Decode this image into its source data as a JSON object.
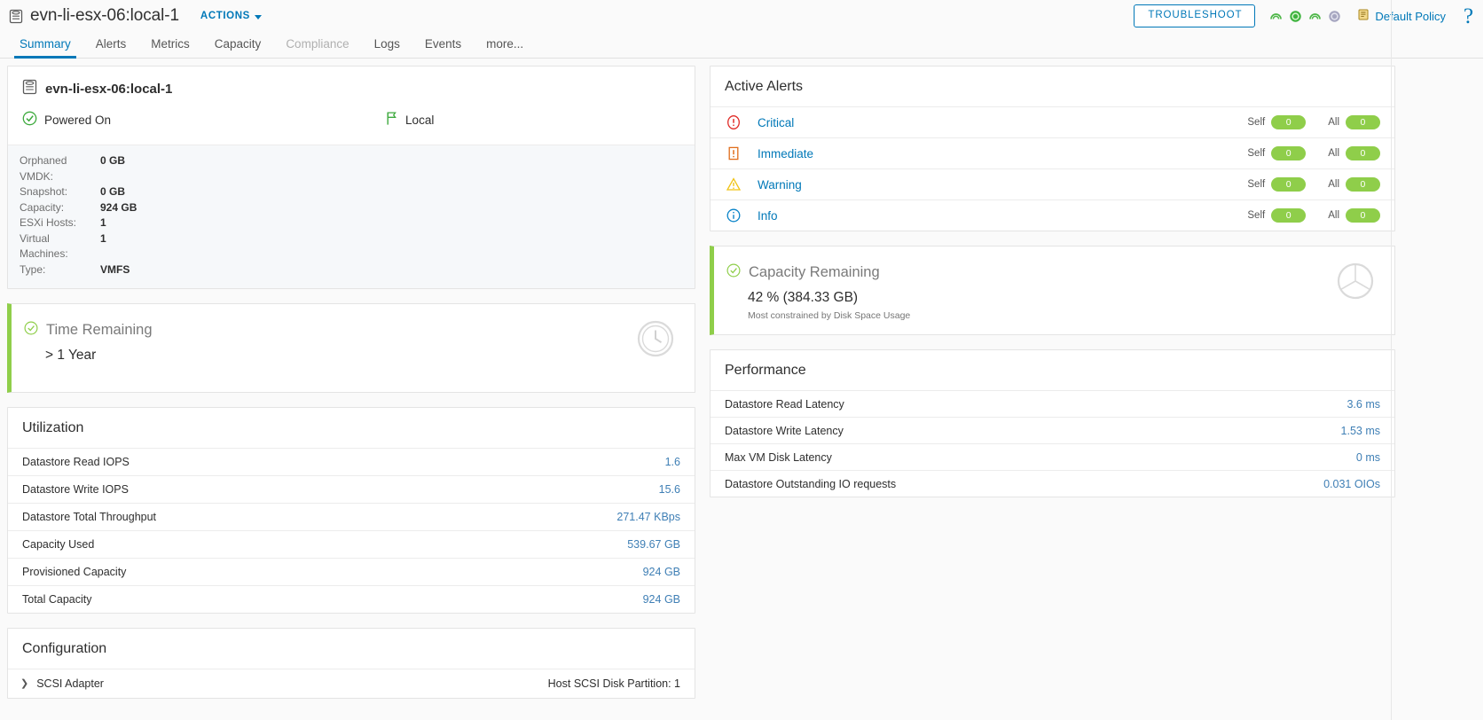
{
  "header": {
    "object_icon": "datastore-icon",
    "title": "evn-li-esx-06:local-1",
    "actions_label": "ACTIONS",
    "troubleshoot_label": "TROUBLESHOOT",
    "policy_label": "Default Policy",
    "help_label": "?",
    "badges": [
      {
        "name": "health-badge",
        "style": "arc-green",
        "color": "#4eb748"
      },
      {
        "name": "risk-badge",
        "style": "circle-green",
        "color": "#3eb33e"
      },
      {
        "name": "efficiency-badge",
        "style": "arc-green",
        "color": "#4eb748"
      },
      {
        "name": "compliance-badge",
        "style": "circle-gray",
        "color": "#a6a6c0"
      }
    ]
  },
  "tabs": [
    {
      "label": "Summary",
      "state": "active"
    },
    {
      "label": "Alerts",
      "state": "normal"
    },
    {
      "label": "Metrics",
      "state": "normal"
    },
    {
      "label": "Capacity",
      "state": "normal"
    },
    {
      "label": "Compliance",
      "state": "disabled"
    },
    {
      "label": "Logs",
      "state": "normal"
    },
    {
      "label": "Events",
      "state": "normal"
    },
    {
      "label": "more...",
      "state": "normal"
    }
  ],
  "object_card": {
    "name": "evn-li-esx-06:local-1",
    "power_state": "Powered On",
    "location": "Local",
    "properties": [
      {
        "key": "Orphaned VMDK:",
        "value": "0 GB"
      },
      {
        "key": "Snapshot:",
        "value": "0 GB"
      },
      {
        "key": "Capacity:",
        "value": "924 GB"
      },
      {
        "key": "ESXi Hosts:",
        "value": "1"
      },
      {
        "key": "Virtual Machines:",
        "value": "1"
      },
      {
        "key": "Type:",
        "value": "VMFS"
      }
    ]
  },
  "active_alerts": {
    "title": "Active Alerts",
    "self_label": "Self",
    "all_label": "All",
    "rows": [
      {
        "icon": "critical-icon",
        "label": "Critical",
        "self": "0",
        "all": "0"
      },
      {
        "icon": "immediate-icon",
        "label": "Immediate",
        "self": "0",
        "all": "0"
      },
      {
        "icon": "warning-icon",
        "label": "Warning",
        "self": "0",
        "all": "0"
      },
      {
        "icon": "info-icon",
        "label": "Info",
        "self": "0",
        "all": "0"
      }
    ]
  },
  "time_remaining": {
    "title": "Time Remaining",
    "value": "> 1 Year",
    "status_color": "#8fce4a",
    "glyph": "clock-icon"
  },
  "capacity_remaining": {
    "title": "Capacity Remaining",
    "value": "42 % (384.33 GB)",
    "subtext": "Most constrained by Disk Space Usage",
    "status_color": "#8fce4a",
    "glyph": "pie-chart-icon"
  },
  "utilization": {
    "title": "Utilization",
    "rows": [
      {
        "name": "Datastore Read IOPS",
        "value": "1.6"
      },
      {
        "name": "Datastore Write IOPS",
        "value": "15.6"
      },
      {
        "name": "Datastore Total Throughput",
        "value": "271.47 KBps"
      },
      {
        "name": "Capacity Used",
        "value": "539.67 GB"
      },
      {
        "name": "Provisioned Capacity",
        "value": "924 GB"
      },
      {
        "name": "Total Capacity",
        "value": "924 GB"
      }
    ]
  },
  "performance": {
    "title": "Performance",
    "rows": [
      {
        "name": "Datastore Read Latency",
        "value": "3.6 ms"
      },
      {
        "name": "Datastore Write Latency",
        "value": "1.53 ms"
      },
      {
        "name": "Max VM Disk Latency",
        "value": "0 ms"
      },
      {
        "name": "Datastore Outstanding IO requests",
        "value": "0.031 OIOs"
      }
    ]
  },
  "configuration": {
    "title": "Configuration",
    "rows": [
      {
        "name": "SCSI Adapter",
        "extra": "Host SCSI Disk Partition: 1",
        "chevron": "chevron-right-icon"
      }
    ]
  }
}
